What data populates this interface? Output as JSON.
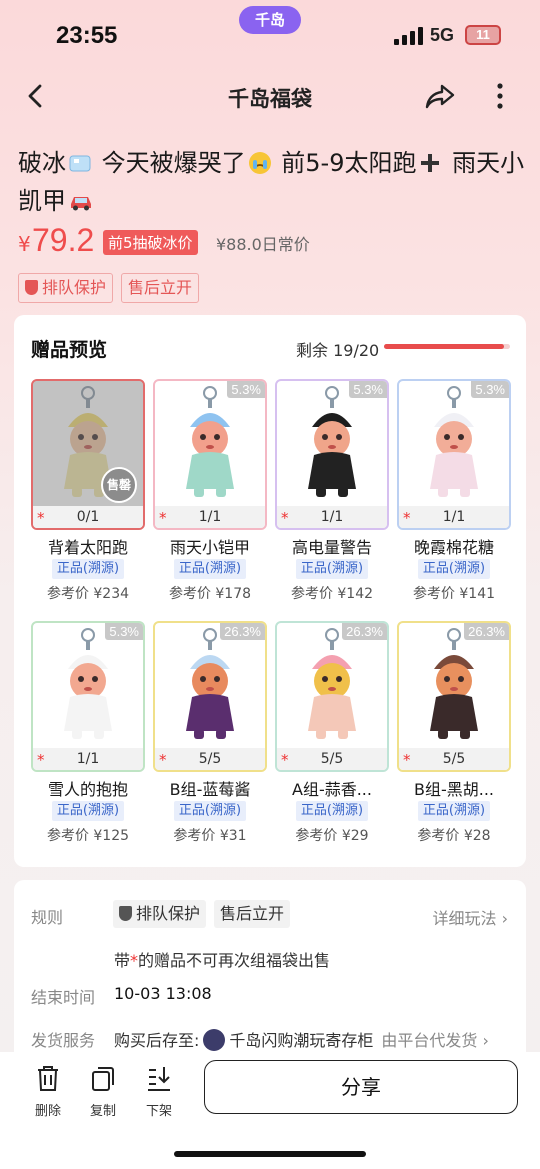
{
  "status": {
    "time": "23:55",
    "app_pill": "千岛",
    "network": "5G",
    "battery": "11"
  },
  "nav": {
    "title": "千岛福袋"
  },
  "product": {
    "title_parts": [
      "破冰",
      "今天被爆哭了",
      "前5-9太阳跑",
      "雨天小凯甲"
    ],
    "currency": "¥",
    "price": "79.2",
    "price_tag": "前5抽破冰价",
    "original_price": "¥88.0日常价",
    "tags": [
      "排队保护",
      "售后立开"
    ]
  },
  "gifts": {
    "title": "赠品预览",
    "remaining": "剩余 19/20",
    "remaining_fraction": 0.95,
    "items": [
      {
        "name": "背着太阳跑",
        "qty": "0/1",
        "pct": "",
        "badge": "正品(溯源)",
        "ref": "参考价 ¥234",
        "sold": true,
        "border": "#e26b6b"
      },
      {
        "name": "雨天小铠甲",
        "qty": "1/1",
        "pct": "5.3%",
        "badge": "正品(溯源)",
        "ref": "参考价 ¥178",
        "sold": false,
        "border": "#f4b8c4"
      },
      {
        "name": "高电量警告",
        "qty": "1/1",
        "pct": "5.3%",
        "badge": "正品(溯源)",
        "ref": "参考价 ¥142",
        "sold": false,
        "border": "#d6c0f0"
      },
      {
        "name": "晚霞棉花糖",
        "qty": "1/1",
        "pct": "5.3%",
        "badge": "正品(溯源)",
        "ref": "参考价 ¥141",
        "sold": false,
        "border": "#bcd0f2"
      },
      {
        "name": "雪人的抱抱",
        "qty": "1/1",
        "pct": "5.3%",
        "badge": "正品(溯源)",
        "ref": "参考价 ¥125",
        "sold": false,
        "border": "#bfe4c4"
      },
      {
        "name": "B组-蓝莓酱",
        "qty": "5/5",
        "pct": "26.3%",
        "badge": "正品(溯源)",
        "ref": "参考价 ¥31",
        "sold": false,
        "border": "#f0e08a"
      },
      {
        "name": "A组-蒜香...",
        "qty": "5/5",
        "pct": "26.3%",
        "badge": "正品(溯源)",
        "ref": "参考价 ¥29",
        "sold": false,
        "border": "#bfe4d6"
      },
      {
        "name": "B组-黑胡...",
        "qty": "5/5",
        "pct": "26.3%",
        "badge": "正品(溯源)",
        "ref": "参考价 ¥28",
        "sold": false,
        "border": "#f0e08a"
      }
    ]
  },
  "rules": {
    "label_rules": "规则",
    "tags": [
      "排队保护",
      "售后立开"
    ],
    "details_link": "详细玩法 ›",
    "note_prefix": "带",
    "note_star": "*",
    "note_suffix": "的赠品不可再次组福袋出售",
    "label_end": "结束时间",
    "end_time": "10-03 13:08",
    "label_ship": "发货服务",
    "ship_prefix": "购买后存至:",
    "ship_store": "千岛闪购潮玩寄存柜",
    "ship_suffix": "由平台代发货 ›"
  },
  "bottom": {
    "delete": "删除",
    "copy": "复制",
    "offshelf": "下架",
    "share": "分享"
  }
}
